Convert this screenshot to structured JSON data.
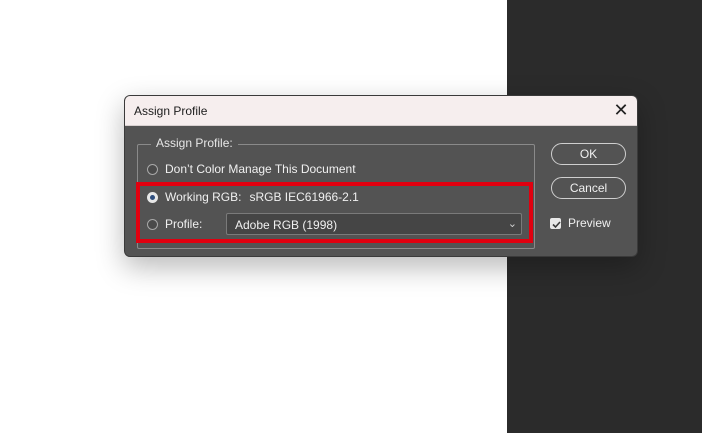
{
  "dialog": {
    "title": "Assign Profile",
    "close_glyph": "✕",
    "group_label": "Assign Profile:",
    "options": [
      {
        "label": "Don’t Color Manage This Document",
        "selected": false
      },
      {
        "label": "Working RGB:",
        "value": "sRGB IEC61966-2.1",
        "selected": true
      },
      {
        "label": "Profile:",
        "selected": false
      }
    ],
    "profile_select": {
      "value": "Adobe RGB (1998)",
      "chevron": "⌄"
    },
    "buttons": {
      "ok": "OK",
      "cancel": "Cancel"
    },
    "preview": {
      "label": "Preview",
      "checked": true
    },
    "highlight_color": "#e0000f"
  }
}
